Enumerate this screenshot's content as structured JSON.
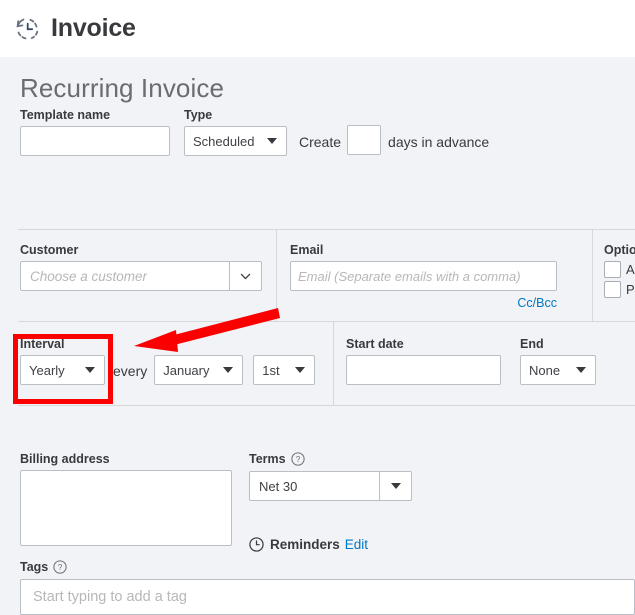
{
  "header": {
    "icon": "recurring-clock-icon",
    "title": "Invoice"
  },
  "page": {
    "title": "Recurring Invoice"
  },
  "row1": {
    "template_name_label": "Template name",
    "template_name_value": "",
    "template_name_placeholder": "",
    "type_label": "Type",
    "type_value": "Scheduled",
    "create_text": "Create",
    "create_days_value": "",
    "advance_text": "days in advance"
  },
  "customer": {
    "label": "Customer",
    "placeholder": "Choose a customer",
    "chevron": "chevron-down-icon"
  },
  "email": {
    "label": "Email",
    "value": "",
    "placeholder": "Email (Separate emails with a comma)",
    "ccbcc_label": "Cc/Bcc"
  },
  "options": {
    "label": "Options",
    "items": [
      {
        "label": "Au",
        "checked": false
      },
      {
        "label": "Pri",
        "checked": false
      }
    ]
  },
  "interval": {
    "label": "Interval",
    "value": "Yearly",
    "every_text": "every",
    "month_value": "January",
    "day_value": "1st"
  },
  "schedule": {
    "start_date_label": "Start date",
    "start_date_value": "",
    "start_date_placeholder": "",
    "end_label": "End",
    "end_value": "None"
  },
  "billing": {
    "label": "Billing address",
    "value": ""
  },
  "terms": {
    "label": "Terms",
    "help_icon": "help-circle-icon",
    "value": "Net 30"
  },
  "reminders": {
    "icon": "clock-icon",
    "label": "Reminders",
    "edit_label": "Edit"
  },
  "tags": {
    "label": "Tags",
    "help_icon": "help-circle-icon",
    "value": "",
    "placeholder": "Start typing to add a tag"
  },
  "annotation": {
    "highlight_color": "#fa0000",
    "arrow_color": "#fa0000",
    "target": "interval-field"
  },
  "colors": {
    "page_background": "#f1f3f7",
    "header_background": "#ffffff",
    "text": "#393a3d",
    "muted_text": "#6b6c72",
    "placeholder": "#b7b7b9",
    "link": "#0077c5",
    "border": "#babec5",
    "divider": "#d4d7dc"
  }
}
